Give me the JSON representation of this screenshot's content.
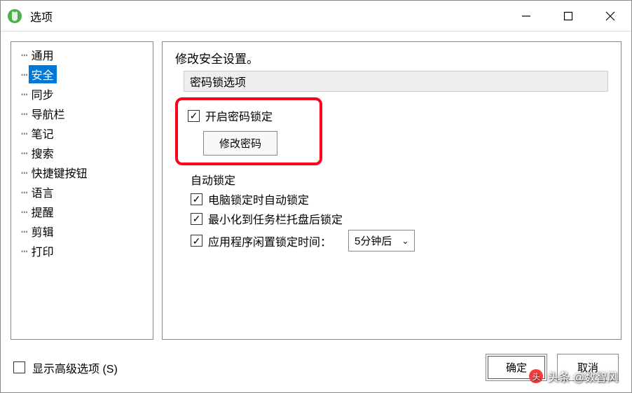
{
  "window": {
    "title": "选项"
  },
  "sidebar": {
    "items": [
      {
        "label": "通用",
        "selected": false
      },
      {
        "label": "安全",
        "selected": true
      },
      {
        "label": "同步",
        "selected": false
      },
      {
        "label": "导航栏",
        "selected": false
      },
      {
        "label": "笔记",
        "selected": false
      },
      {
        "label": "搜索",
        "selected": false
      },
      {
        "label": "快捷键按钮",
        "selected": false
      },
      {
        "label": "语言",
        "selected": false
      },
      {
        "label": "提醒",
        "selected": false
      },
      {
        "label": "剪辑",
        "selected": false
      },
      {
        "label": "打印",
        "selected": false
      }
    ]
  },
  "main": {
    "desc": "修改安全设置。",
    "password_section": "密码锁选项",
    "enable_password": "开启密码锁定",
    "change_password_btn": "修改密码",
    "autolock_header": "自动锁定",
    "lock_on_computer_lock": "电脑锁定时自动锁定",
    "lock_on_minimize": "最小化到任务栏托盘后锁定",
    "idle_lock": "应用程序闲置锁定时间：",
    "idle_value": "5分钟后"
  },
  "footer": {
    "show_advanced": "显示高级选项 (S)",
    "ok": "确定",
    "cancel": "取消"
  },
  "watermark": {
    "text": "头条 @数智风"
  }
}
